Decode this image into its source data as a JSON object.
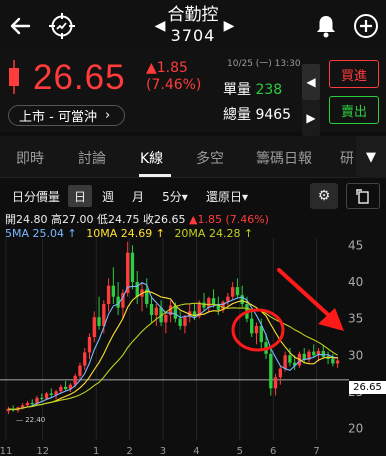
{
  "header": {
    "back_icon": "back-arrow-icon",
    "trend_icon": "trend-target-icon",
    "stock_name": "合勤控",
    "stock_code": "3704",
    "bell_icon": "bell-icon",
    "add_icon": "add-circle-icon"
  },
  "quote": {
    "price": "26.65",
    "change": "▲1.85",
    "change_pct": "(7.46%)",
    "time": "10/25 (一) 13:30",
    "unit_vol_label": "單量",
    "unit_vol_value": "238",
    "total_vol_label": "總量",
    "total_vol_value": "9465",
    "market_tag": "上市 - 可當沖",
    "buy_label": "買進",
    "sell_label": "賣出",
    "colors": {
      "up": "#ff3b3b",
      "down": "#2ecc40"
    }
  },
  "tabs": [
    "即時",
    "討論",
    "K線",
    "多空",
    "籌碼日報",
    "研"
  ],
  "active_tab": "K線",
  "toolbar": {
    "items": [
      "日分價量",
      "日",
      "週",
      "月",
      "5分▾",
      "還原日▾"
    ],
    "selected": "日",
    "gear_icon": "gear-icon",
    "rotate_icon": "rotate-screen-icon"
  },
  "ohlc": {
    "open_label": "開",
    "open": "24.80",
    "high_label": "高",
    "high": "27.00",
    "low_label": "低",
    "low": "24.75",
    "close_label": "收",
    "close": "26.65",
    "change": "▲1.85 (7.46%)"
  },
  "ma": {
    "ma5": "5MA 25.04 ↑",
    "ma10": "10MA 24.69 ↑",
    "ma20": "20MA 24.28 ↑",
    "colors": {
      "ma5": "#7ab8ff",
      "ma10": "#ffe033",
      "ma20": "#c0d020"
    }
  },
  "chart_data": {
    "type": "candlestick",
    "title": "",
    "y_ticks": [
      "45",
      "40",
      "35",
      "30",
      "25",
      "20"
    ],
    "x_ticks": [
      "11",
      "12",
      "1",
      "2",
      "3",
      "4",
      "5",
      "6",
      "7"
    ],
    "ylim": [
      19,
      46
    ],
    "last_price": "26.65",
    "low_annotation": "22.40",
    "candles": [
      [
        22.4,
        23.0,
        22.0,
        22.7
      ],
      [
        22.7,
        23.2,
        22.3,
        22.5
      ],
      [
        22.5,
        23.0,
        22.2,
        22.9
      ],
      [
        22.9,
        23.5,
        22.6,
        23.2
      ],
      [
        23.2,
        23.8,
        22.9,
        23.5
      ],
      [
        23.5,
        24.0,
        23.0,
        23.4
      ],
      [
        23.4,
        24.5,
        23.1,
        24.2
      ],
      [
        24.2,
        24.8,
        23.8,
        24.1
      ],
      [
        24.1,
        25.0,
        23.9,
        24.8
      ],
      [
        24.8,
        25.5,
        24.2,
        24.6
      ],
      [
        24.6,
        25.3,
        24.0,
        25.1
      ],
      [
        25.1,
        26.0,
        24.8,
        25.7
      ],
      [
        25.7,
        26.5,
        25.2,
        25.4
      ],
      [
        25.4,
        26.2,
        25.0,
        26.0
      ],
      [
        26.0,
        27.5,
        25.6,
        27.2
      ],
      [
        27.2,
        29.0,
        26.8,
        28.6
      ],
      [
        28.6,
        31.0,
        28.0,
        30.4
      ],
      [
        30.4,
        33.0,
        29.5,
        32.5
      ],
      [
        32.5,
        36.0,
        31.8,
        35.2
      ],
      [
        35.2,
        38.0,
        33.5,
        34.0
      ],
      [
        34.0,
        37.5,
        33.0,
        37.0
      ],
      [
        37.0,
        40.5,
        36.0,
        39.5
      ],
      [
        39.5,
        42.0,
        37.0,
        38.0
      ],
      [
        38.0,
        40.0,
        35.5,
        36.5
      ],
      [
        36.5,
        39.0,
        35.0,
        38.5
      ],
      [
        38.5,
        45.5,
        38.0,
        44.0
      ],
      [
        44.0,
        45.0,
        39.0,
        40.0
      ],
      [
        40.0,
        41.5,
        37.0,
        38.0
      ],
      [
        38.0,
        40.0,
        36.0,
        39.0
      ],
      [
        39.0,
        40.5,
        36.5,
        37.0
      ],
      [
        37.0,
        38.0,
        34.5,
        35.5
      ],
      [
        35.5,
        37.0,
        34.0,
        36.5
      ],
      [
        36.5,
        37.5,
        34.0,
        34.5
      ],
      [
        34.5,
        36.0,
        33.0,
        35.5
      ],
      [
        35.5,
        37.5,
        34.5,
        36.8
      ],
      [
        36.8,
        37.2,
        34.5,
        35.0
      ],
      [
        35.0,
        36.0,
        33.5,
        34.0
      ],
      [
        34.0,
        35.5,
        33.0,
        35.2
      ],
      [
        35.2,
        37.0,
        34.5,
        36.0
      ],
      [
        36.0,
        37.0,
        34.8,
        35.3
      ],
      [
        35.3,
        37.5,
        35.0,
        37.2
      ],
      [
        37.2,
        38.5,
        36.0,
        36.5
      ],
      [
        36.5,
        38.0,
        35.8,
        37.8
      ],
      [
        37.8,
        39.0,
        36.5,
        37.0
      ],
      [
        37.0,
        38.0,
        35.5,
        36.2
      ],
      [
        36.2,
        37.5,
        35.8,
        37.3
      ],
      [
        37.3,
        38.5,
        36.8,
        38.0
      ],
      [
        38.0,
        40.0,
        37.5,
        39.3
      ],
      [
        39.3,
        40.5,
        37.8,
        38.2
      ],
      [
        38.2,
        39.5,
        36.5,
        37.0
      ],
      [
        37.0,
        38.0,
        34.5,
        35.0
      ],
      [
        35.0,
        36.0,
        32.5,
        33.0
      ],
      [
        33.0,
        34.5,
        31.5,
        34.0
      ],
      [
        34.0,
        35.0,
        31.0,
        31.8
      ],
      [
        31.8,
        33.0,
        29.5,
        30.2
      ],
      [
        30.2,
        30.8,
        24.5,
        25.5
      ],
      [
        25.5,
        27.5,
        24.5,
        27.0
      ],
      [
        27.0,
        28.5,
        26.0,
        28.2
      ],
      [
        28.2,
        30.5,
        27.8,
        30.0
      ],
      [
        30.0,
        31.0,
        28.5,
        29.0
      ],
      [
        29.0,
        30.0,
        28.0,
        28.6
      ],
      [
        28.6,
        30.5,
        28.3,
        30.2
      ],
      [
        30.2,
        31.0,
        29.0,
        29.4
      ],
      [
        29.4,
        30.8,
        29.0,
        30.5
      ],
      [
        30.5,
        31.5,
        29.8,
        30.0
      ],
      [
        30.0,
        31.0,
        29.2,
        30.6
      ],
      [
        30.6,
        31.3,
        29.5,
        29.8
      ],
      [
        29.8,
        30.5,
        28.8,
        29.5
      ],
      [
        29.5,
        30.2,
        28.5,
        28.9
      ],
      [
        28.9,
        29.8,
        28.3,
        29.3
      ]
    ]
  }
}
